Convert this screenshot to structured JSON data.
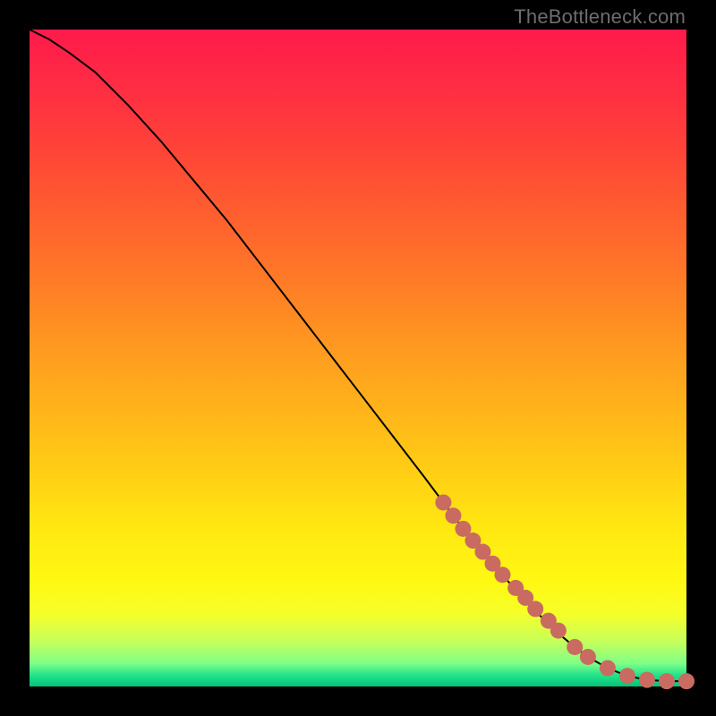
{
  "attribution": "TheBottleneck.com",
  "colors": {
    "background_page": "#000000",
    "line": "#000000",
    "marker": "#c96b60",
    "attribution_text": "#6d6d6d"
  },
  "chart_data": {
    "type": "line",
    "title": "",
    "xlabel": "",
    "ylabel": "",
    "xlim": [
      0,
      100
    ],
    "ylim": [
      0,
      100
    ],
    "grid": false,
    "series": [
      {
        "name": "bottleneck-curve",
        "x": [
          0,
          3,
          6,
          10,
          15,
          20,
          25,
          30,
          35,
          40,
          45,
          50,
          55,
          60,
          63,
          66,
          69,
          72,
          75,
          78,
          80,
          83,
          85,
          88,
          91,
          94,
          97,
          100
        ],
        "y": [
          100,
          98.5,
          96.5,
          93.5,
          88.5,
          83,
          77,
          71,
          64.5,
          58,
          51.5,
          45,
          38.5,
          32,
          28,
          24,
          20.5,
          17,
          13.5,
          10.5,
          8.5,
          6,
          4.5,
          2.8,
          1.6,
          1.0,
          0.8,
          0.8
        ]
      }
    ],
    "markers": {
      "name": "highlighted-points",
      "x": [
        63,
        64.5,
        66,
        67.5,
        69,
        70.5,
        72,
        74,
        75.5,
        77,
        79,
        80.5,
        83,
        85,
        88,
        91,
        94,
        97,
        100
      ],
      "y": [
        28,
        26,
        24,
        22.2,
        20.5,
        18.7,
        17,
        15,
        13.5,
        11.8,
        10,
        8.5,
        6,
        4.5,
        2.8,
        1.6,
        1.0,
        0.8,
        0.8
      ]
    }
  }
}
